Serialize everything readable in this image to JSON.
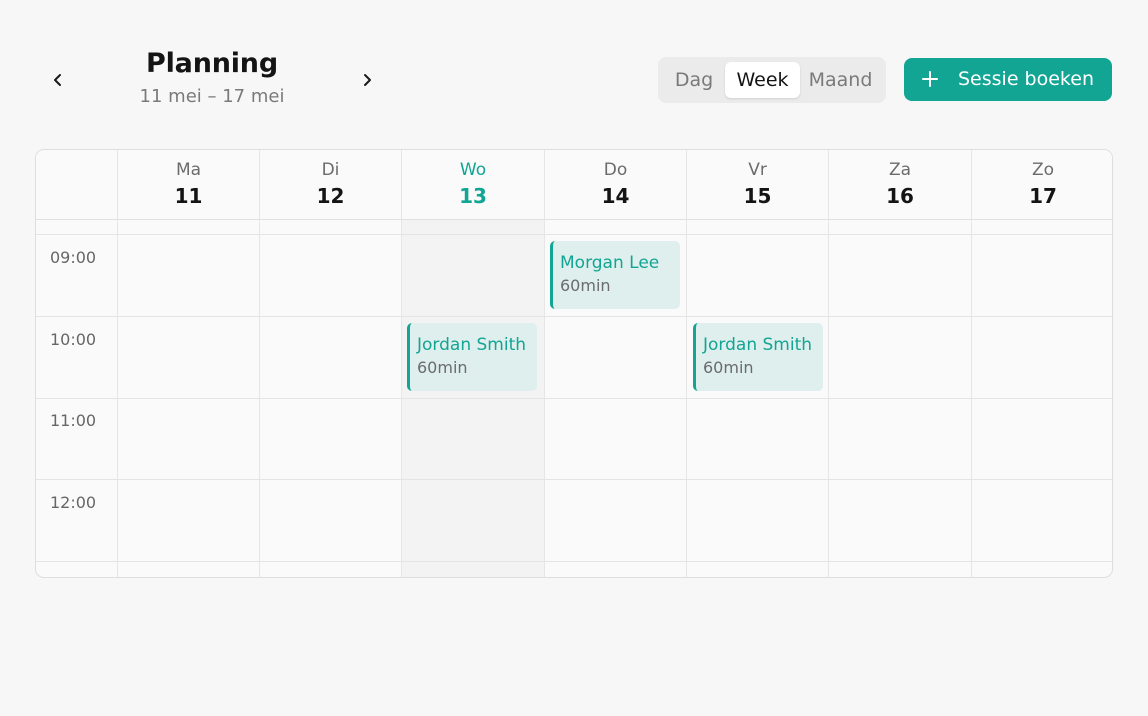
{
  "header": {
    "title": "Planning",
    "date_range": "11 mei – 17 mei",
    "prev_icon": "chevron-left-icon",
    "next_icon": "chevron-right-icon"
  },
  "view_toggle": {
    "options": [
      "Dag",
      "Week",
      "Maand"
    ],
    "selected": "Week"
  },
  "book_button": {
    "label": "Sessie boeken",
    "icon": "plus-icon"
  },
  "calendar": {
    "days": [
      {
        "name": "Ma",
        "num": "11"
      },
      {
        "name": "Di",
        "num": "12"
      },
      {
        "name": "Wo",
        "num": "13",
        "today": true
      },
      {
        "name": "Do",
        "num": "14"
      },
      {
        "name": "Vr",
        "num": "15"
      },
      {
        "name": "Za",
        "num": "16"
      },
      {
        "name": "Zo",
        "num": "17"
      }
    ],
    "hours": [
      "09:00",
      "10:00",
      "11:00",
      "12:00"
    ],
    "events": [
      {
        "name": "Morgan Lee",
        "duration": "60min",
        "day": "Do",
        "start": "09:00"
      },
      {
        "name": "Jordan Smith",
        "duration": "60min",
        "day": "Wo",
        "start": "10:00"
      },
      {
        "name": "Jordan Smith",
        "duration": "60min",
        "day": "Vr",
        "start": "10:00"
      }
    ]
  },
  "colors": {
    "accent": "#12a594",
    "event_bg": "#deefed",
    "background": "#f7f7f7"
  }
}
